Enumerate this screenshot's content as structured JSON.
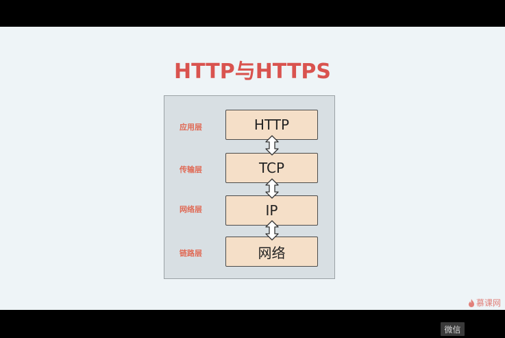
{
  "slide": {
    "title": "HTTP与HTTPS",
    "layers": [
      {
        "label": "应用层",
        "protocol": "HTTP"
      },
      {
        "label": "传输层",
        "protocol": "TCP"
      },
      {
        "label": "网络层",
        "protocol": "IP"
      },
      {
        "label": "链路层",
        "protocol": "网络"
      }
    ],
    "watermark": "慕课网"
  },
  "overlay": {
    "wechat_label": "微信"
  },
  "colors": {
    "title": "#d9534f",
    "label": "#e06a55",
    "box_fill": "#f5dfc8",
    "frame_fill": "#d8dfe3",
    "slide_bg": "#eef4f7"
  }
}
